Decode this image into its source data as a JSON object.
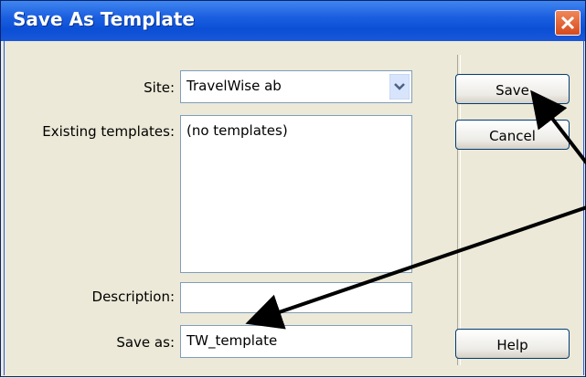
{
  "window": {
    "title": "Save As Template"
  },
  "form": {
    "site_label": "Site:",
    "site_value": "TravelWise ab",
    "existing_label": "Existing templates:",
    "existing_items": [
      "(no templates)"
    ],
    "description_label": "Description:",
    "description_value": "",
    "saveas_label": "Save as:",
    "saveas_value": "TW_template"
  },
  "buttons": {
    "save": "Save",
    "cancel": "Cancel",
    "help": "Help"
  },
  "colors": {
    "titlebar": "#0b4fd6",
    "close": "#d64a1c",
    "dialog_bg": "#ece9d8",
    "arrow": "#000000"
  },
  "icons": [
    "close-icon",
    "chevron-down-icon"
  ]
}
